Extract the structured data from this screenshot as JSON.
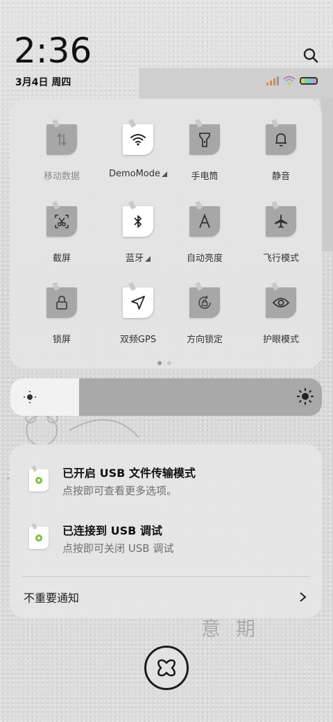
{
  "status": {
    "time": "2:36",
    "date": "3月4日 周四"
  },
  "colors": {
    "tile_inactive": "#a7a7a7",
    "tile_active": "#ffffff",
    "panel_bg": "#e4e4e4"
  },
  "quick_tiles": [
    {
      "label": "移动数据",
      "icon": "mobile-data-icon",
      "active": false,
      "dim": true
    },
    {
      "label": "DemoMode",
      "icon": "wifi-icon",
      "active": true,
      "expand": true
    },
    {
      "label": "手电筒",
      "icon": "flashlight-icon",
      "active": false
    },
    {
      "label": "静音",
      "icon": "bell-icon",
      "active": false
    },
    {
      "label": "截屏",
      "icon": "screenshot-icon",
      "active": false
    },
    {
      "label": "蓝牙",
      "icon": "bluetooth-icon",
      "active": true,
      "expand": true
    },
    {
      "label": "自动亮度",
      "icon": "auto-brightness-icon",
      "active": false
    },
    {
      "label": "飞行模式",
      "icon": "airplane-icon",
      "active": false
    },
    {
      "label": "锁屏",
      "icon": "lock-icon",
      "active": false
    },
    {
      "label": "双频GPS",
      "icon": "gps-icon",
      "active": true
    },
    {
      "label": "方向锁定",
      "icon": "rotation-lock-icon",
      "active": false
    },
    {
      "label": "护眼模式",
      "icon": "eye-icon",
      "active": false
    }
  ],
  "pager": {
    "pages": 2,
    "current": 1
  },
  "brightness": {
    "level": 0.22
  },
  "notifications": [
    {
      "title": "已开启 USB 文件传输模式",
      "subtitle": "点按即可查看更多选项。",
      "icon": "android-settings-icon"
    },
    {
      "title": "已连接到 USB 调试",
      "subtitle": "点按即可关闭 USB 调试",
      "icon": "android-settings-icon"
    }
  ],
  "unimportant": {
    "label": "不重要通知"
  },
  "wallpaper_text": "意期"
}
